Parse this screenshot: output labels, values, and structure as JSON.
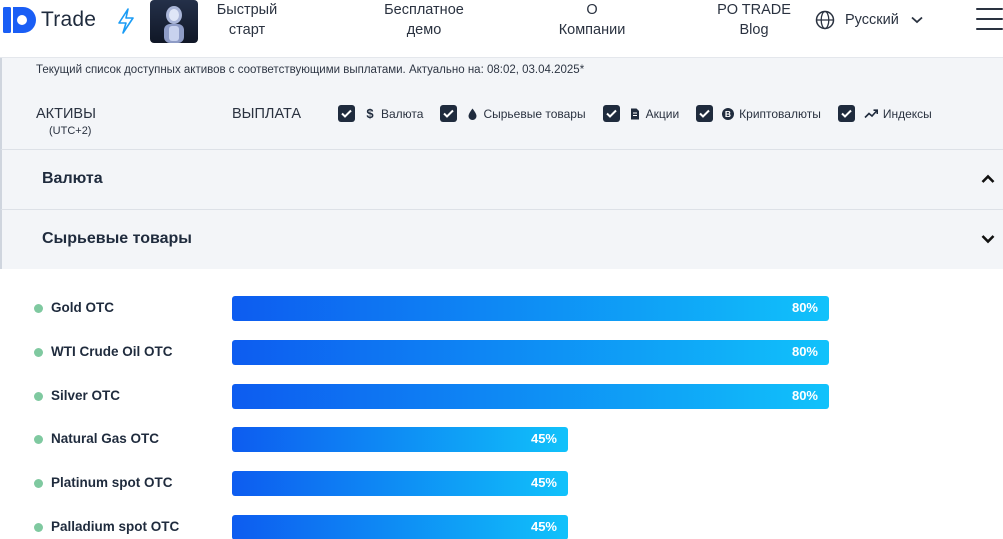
{
  "header": {
    "logo_text": "Trade",
    "nav": [
      {
        "line1": "Быстрый",
        "line2": "старт"
      },
      {
        "line1": "Бесплатное",
        "line2": "демо"
      },
      {
        "line1": "О",
        "line2": "Компании"
      },
      {
        "line1": "PO TRADE",
        "line2": "Blog"
      }
    ],
    "language": "Русский"
  },
  "info": {
    "text": "Текущий список доступных активов с соответствующими выплатами. Актуально на: 08:02, 03.04.2025*",
    "assets_label": "АКТИВЫ",
    "timezone": "(UTC+2)",
    "payout_label": "ВЫПЛАТА",
    "filters": [
      {
        "label": "Валюта",
        "icon": "dollar-icon",
        "checked": true
      },
      {
        "label": "Сырьевые товары",
        "icon": "drop-icon",
        "checked": true
      },
      {
        "label": "Акции",
        "icon": "document-icon",
        "checked": true
      },
      {
        "label": "Криптовалюты",
        "icon": "bitcoin-icon",
        "checked": true
      },
      {
        "label": "Индексы",
        "icon": "trend-up-icon",
        "checked": true
      }
    ]
  },
  "sections": [
    {
      "title": "Валюта",
      "expanded": false
    },
    {
      "title": "Сырьевые товары",
      "expanded": true
    }
  ],
  "assets": [
    {
      "name": "Gold OTC",
      "payout": "80%",
      "value": 80
    },
    {
      "name": "WTI Crude Oil OTC",
      "payout": "80%",
      "value": 80
    },
    {
      "name": "Silver OTC",
      "payout": "80%",
      "value": 80
    },
    {
      "name": "Natural Gas OTC",
      "payout": "45%",
      "value": 45
    },
    {
      "name": "Platinum spot OTC",
      "payout": "45%",
      "value": 45
    },
    {
      "name": "Palladium spot OTC",
      "payout": "45%",
      "value": 45
    }
  ],
  "colors": {
    "brand": "#1a5ef5",
    "bar_start": "#0d5cf0",
    "bar_end": "#11c2fb",
    "status_dot": "#7fc9a0",
    "dark": "#1f2b3d"
  }
}
